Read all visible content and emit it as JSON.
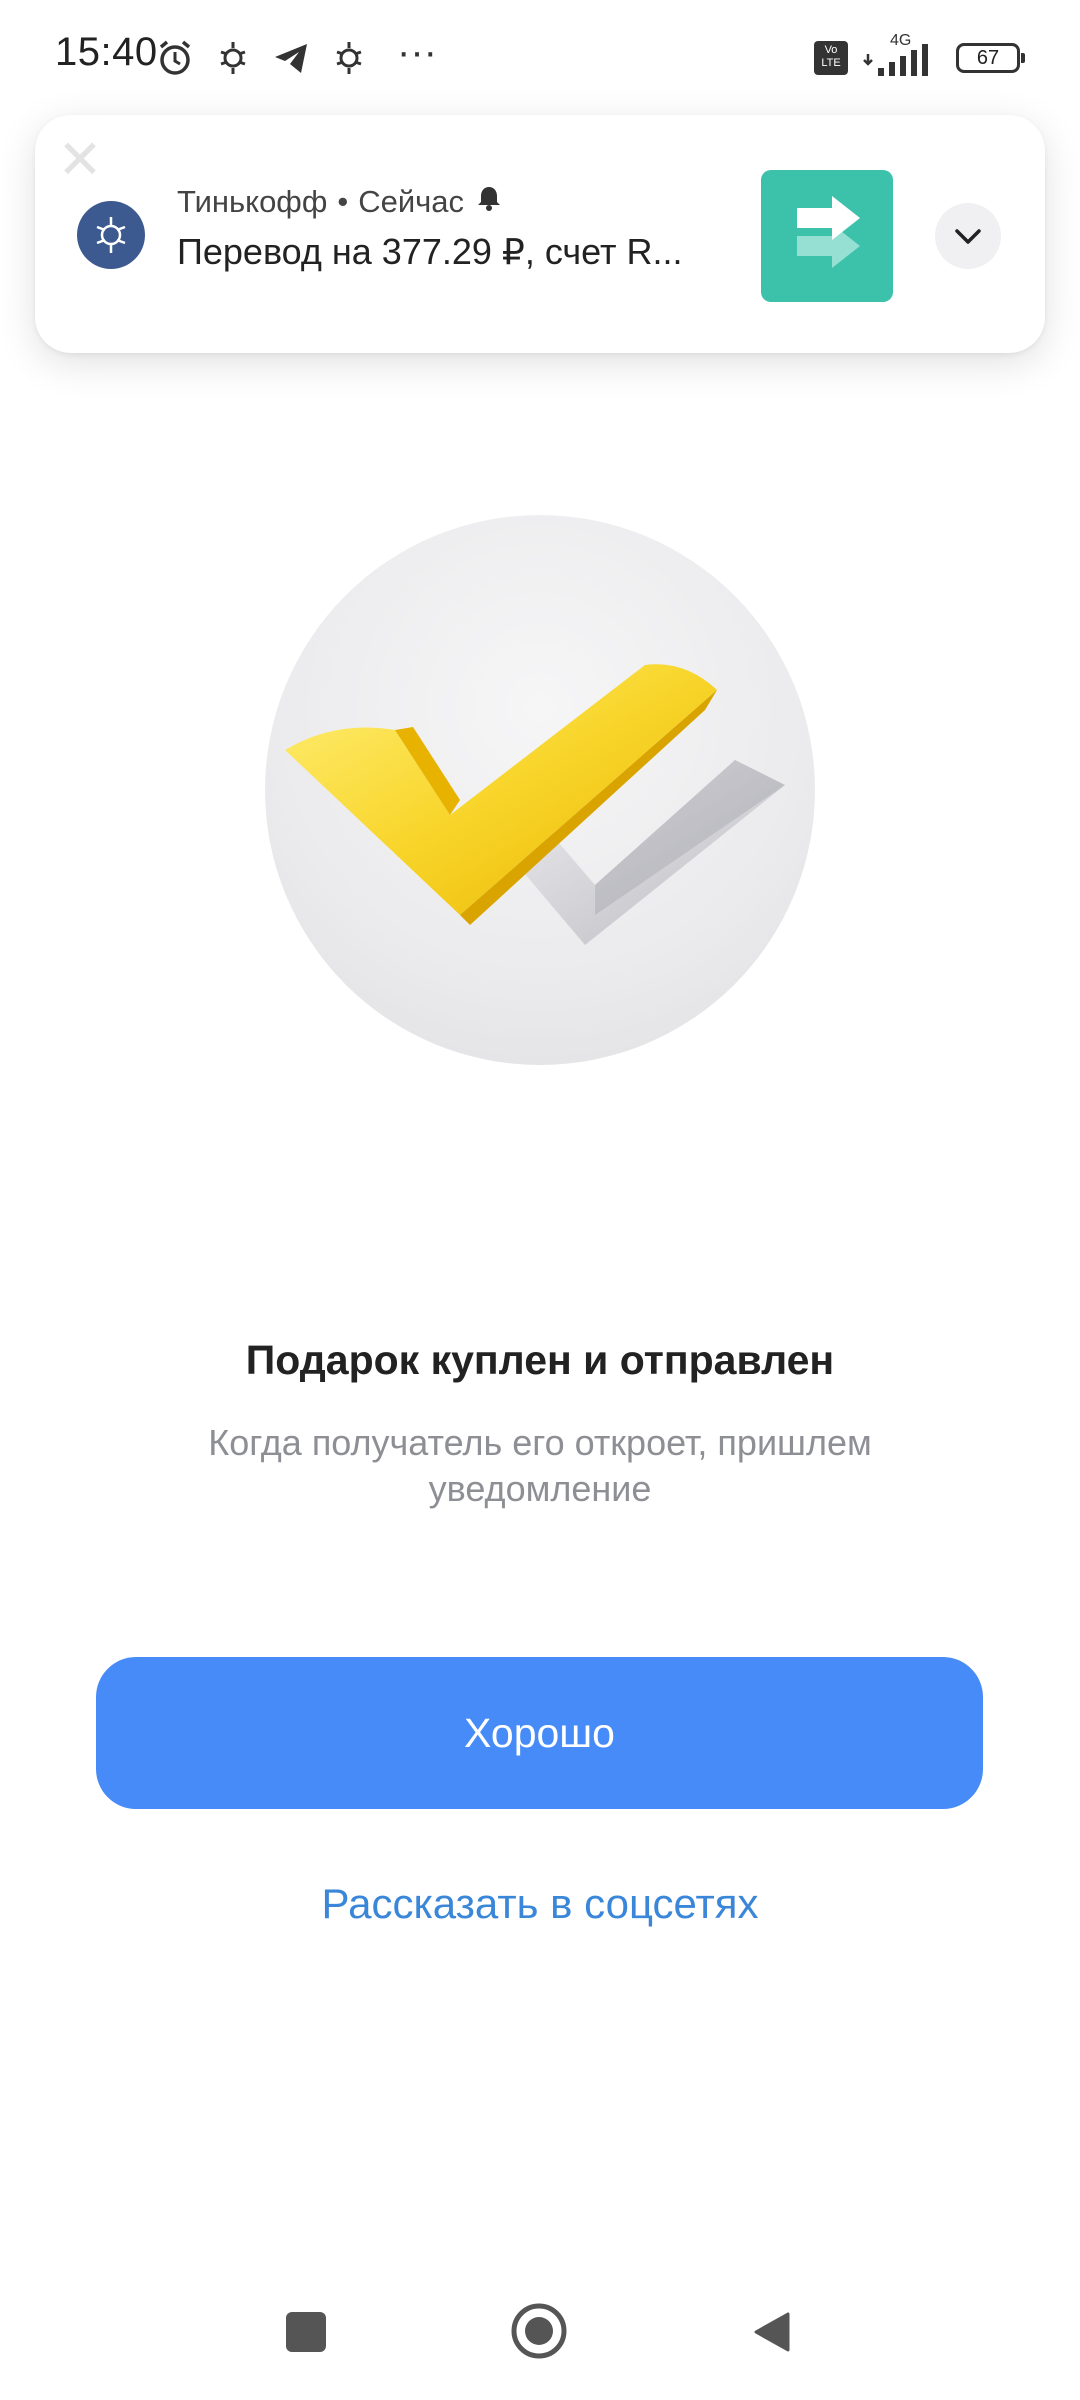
{
  "status_bar": {
    "time": "15:40",
    "more": "···",
    "volte": "Vo LTE",
    "network": "4G",
    "battery": "67"
  },
  "notification": {
    "app_name": "Тинькофф",
    "separator": "•",
    "time": "Сейчас",
    "body": "Перевод на 377.29 ₽, счет R...",
    "close_glyph": "✕",
    "thumbnail_color": "#3cc1ab"
  },
  "main": {
    "title": "Подарок куплен и отправлен",
    "subtitle": "Когда получатель его откроет, пришлем уведомление",
    "primary_button": "Хорошо",
    "share_link": "Рассказать в соцсетях"
  },
  "colors": {
    "accent": "#468bf7",
    "link": "#3a86d8",
    "check_primary": "#f5cc1a",
    "check_secondary": "#c8c8cc"
  }
}
